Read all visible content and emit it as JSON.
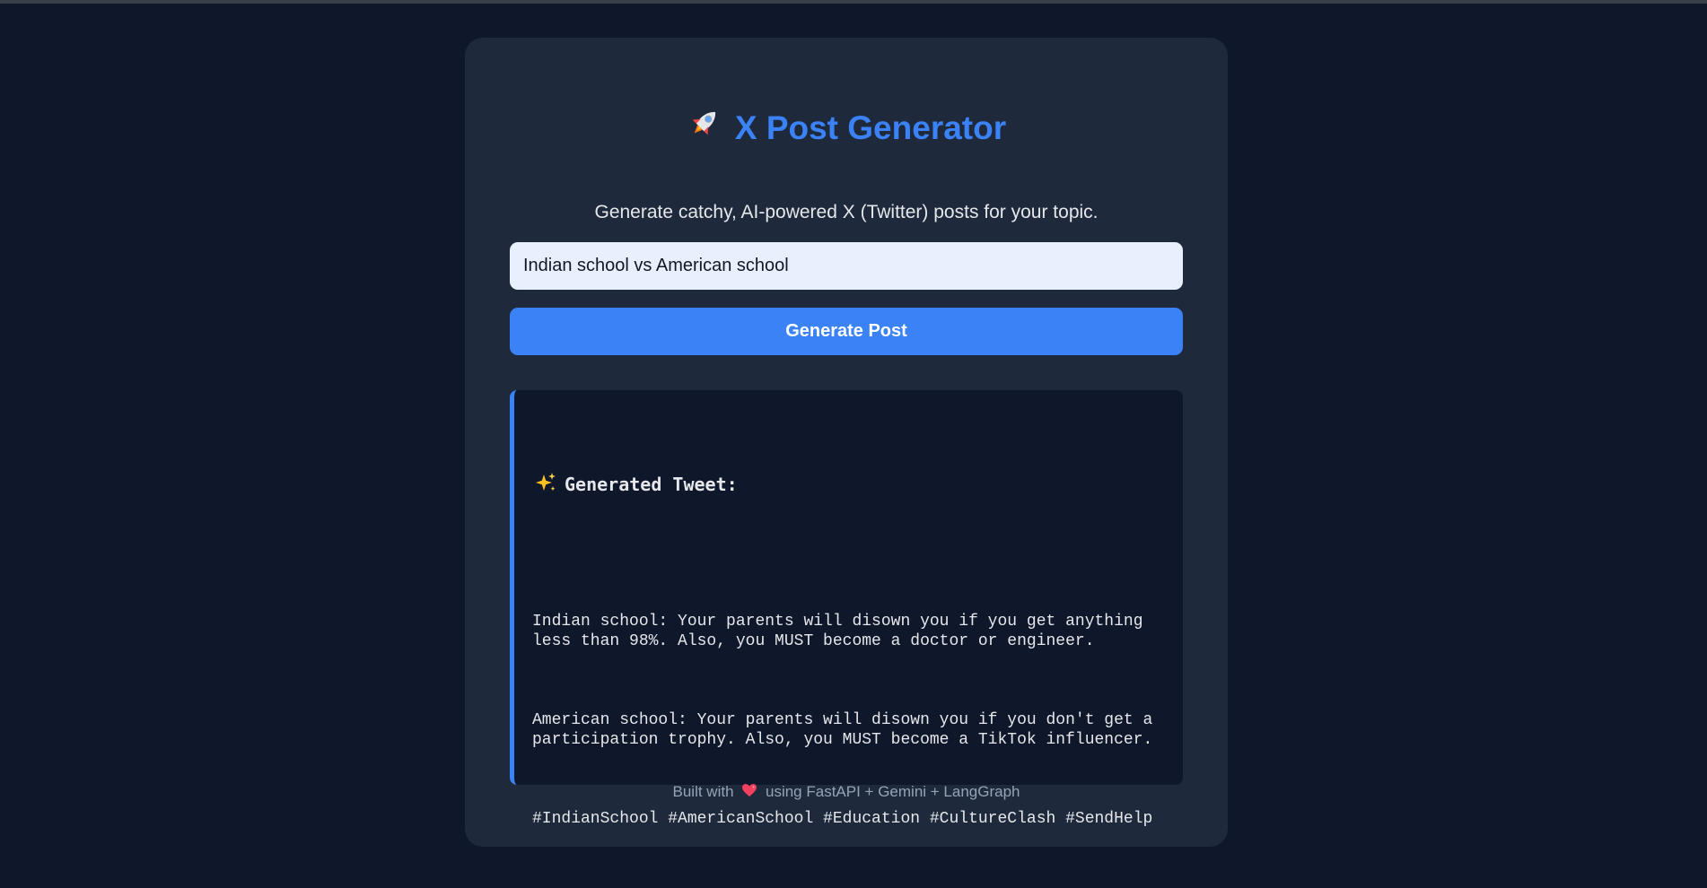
{
  "header": {
    "title": "X Post Generator",
    "title_icon": "rocket-icon",
    "subtitle": "Generate catchy, AI-powered X (Twitter) posts for your topic."
  },
  "form": {
    "topic_value": "Indian school vs American school",
    "generate_label": "Generate Post"
  },
  "result": {
    "heading_icon": "sparkles-icon",
    "heading": "Generated Tweet:",
    "paragraph_1": "Indian school: Your parents will disown you if you get anything less than 98%. Also, you MUST become a doctor or engineer.",
    "paragraph_2": "American school: Your parents will disown you if you don't get a participation trophy. Also, you MUST become a TikTok influencer.",
    "hashtags": "#IndianSchool #AmericanSchool #Education #CultureClash #SendHelp"
  },
  "footer": {
    "prefix": "Built with",
    "heart_icon": "heart-icon",
    "suffix": "using FastAPI + Gemini + LangGraph"
  },
  "colors": {
    "background": "#0f172a",
    "card": "#1e293b",
    "accent": "#3b82f6",
    "input_bg": "#e8effd",
    "text_light": "#e5e7eb",
    "footer_text": "#94a3b8"
  }
}
